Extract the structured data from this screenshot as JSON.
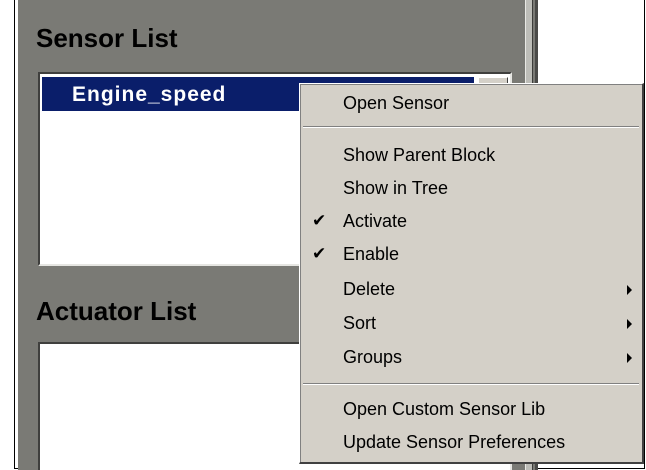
{
  "sensor_panel": {
    "title": "Sensor List",
    "items": [
      {
        "label": "Engine_speed",
        "selected": true
      }
    ]
  },
  "actuator_panel": {
    "title": "Actuator List",
    "items": []
  },
  "context_menu": {
    "items": [
      {
        "label": "Open Sensor",
        "checked": false,
        "submenu": false
      },
      {
        "label": "Show Parent Block",
        "checked": false,
        "submenu": false
      },
      {
        "label": "Show in Tree",
        "checked": false,
        "submenu": false
      },
      {
        "label": "Activate",
        "checked": true,
        "submenu": false
      },
      {
        "label": "Enable",
        "checked": true,
        "submenu": false
      },
      {
        "label": "Delete",
        "checked": false,
        "submenu": true
      },
      {
        "label": "Sort",
        "checked": false,
        "submenu": true
      },
      {
        "label": "Groups",
        "checked": false,
        "submenu": true
      },
      {
        "label": "Open Custom Sensor Lib",
        "checked": false,
        "submenu": false
      },
      {
        "label": "Update Sensor Preferences",
        "checked": false,
        "submenu": false
      }
    ],
    "check_glyph": "✔"
  },
  "colors": {
    "panel_bg": "#7a7a75",
    "selection_bg": "#0a1e6a",
    "menu_bg": "#d4d0c8"
  }
}
